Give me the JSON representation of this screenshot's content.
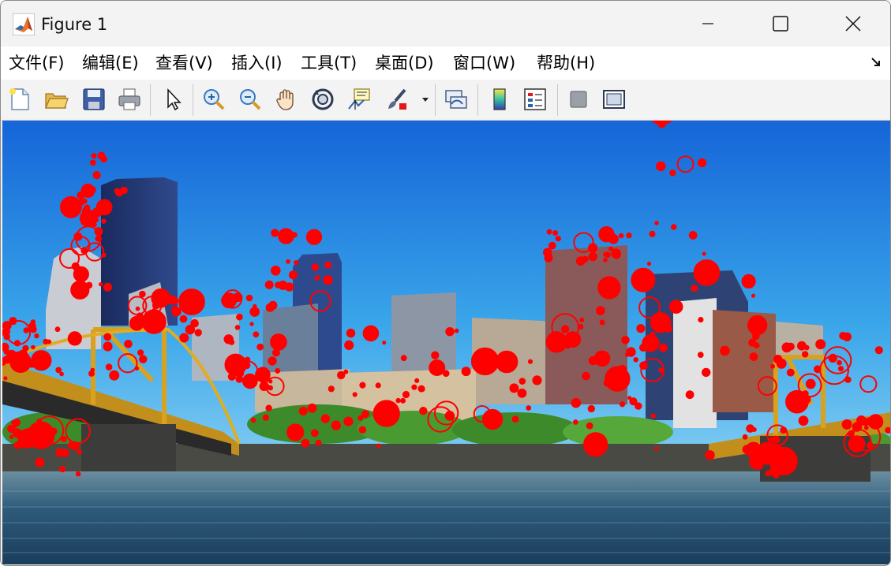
{
  "window": {
    "title": "Figure 1",
    "controls": [
      "minimize",
      "maximize",
      "close"
    ]
  },
  "menu": {
    "items": [
      "文件(F)",
      "编辑(E)",
      "查看(V)",
      "插入(I)",
      "工具(T)",
      "桌面(D)",
      "窗口(W)",
      "帮助(H)"
    ]
  },
  "toolbar": {
    "buttons": [
      "new-figure-icon",
      "open-file-icon",
      "save-icon",
      "print-icon",
      "edit-plot-arrow-icon",
      "zoom-in-icon",
      "zoom-out-icon",
      "pan-hand-icon",
      "rotate-3d-icon",
      "data-cursor-icon",
      "brush-icon",
      "brush-dropdown-icon",
      "link-plot-icon",
      "insert-colorbar-icon",
      "insert-legend-icon",
      "hide-plot-tools-icon",
      "show-plot-tools-icon"
    ]
  },
  "figure": {
    "content": "photograph-of-city-skyline-with-bridge-and-river",
    "marker_color": "#ff0000",
    "marker_style": "circle-overlay"
  },
  "colors": {
    "sky": "#1e88e5",
    "marker": "#ff0000",
    "bridge": "#d8a21e"
  }
}
